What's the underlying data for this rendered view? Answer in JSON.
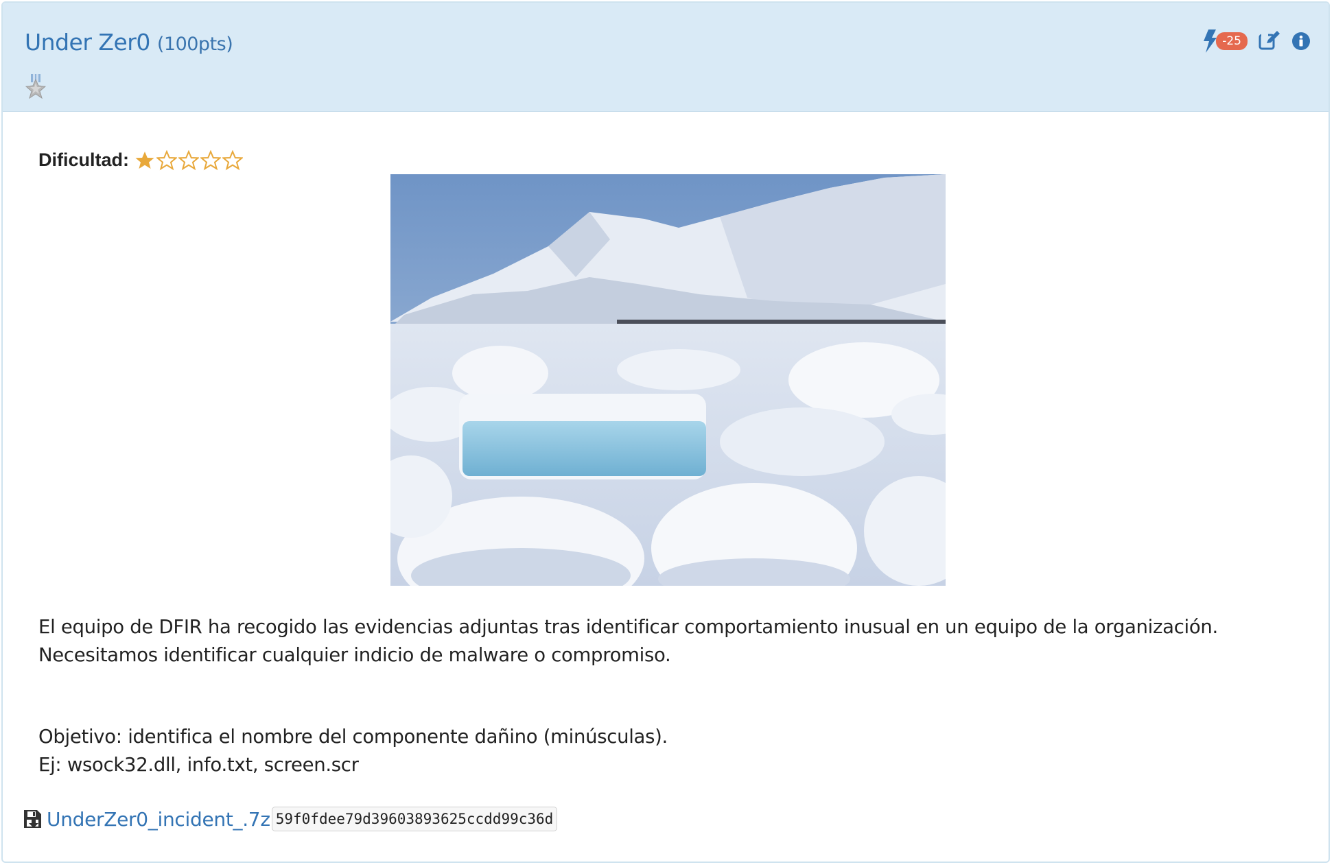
{
  "challenge": {
    "title": "Under Zer0",
    "points": "(100pts)",
    "badge_count": "-25"
  },
  "difficulty": {
    "label": "Dificultad:",
    "rating": 1,
    "max": 5
  },
  "description": {
    "line1": "El equipo de DFIR ha recogido las evidencias adjuntas tras identificar comportamiento inusual en un equipo de la organización.",
    "line2": "Necesitamos identificar cualquier indicio de malware o compromiso.",
    "objective": "Objetivo: identifica el nombre del componente dañino (minúsculas).",
    "example": "Ej: wsock32.dll, info.txt, screen.scr"
  },
  "attachment": {
    "filename": "UnderZer0_incident_.7z",
    "hash": "59f0fdee79d39603893625ccdd99c36d"
  },
  "icons": [
    "medal-icon",
    "bolt-icon",
    "edit-icon",
    "info-icon",
    "floppy-icon",
    "star-icon"
  ],
  "colors": {
    "header_bg": "#d9eaf6",
    "link": "#3374b4",
    "badge": "#e5694e",
    "star": "#e8a83a"
  }
}
